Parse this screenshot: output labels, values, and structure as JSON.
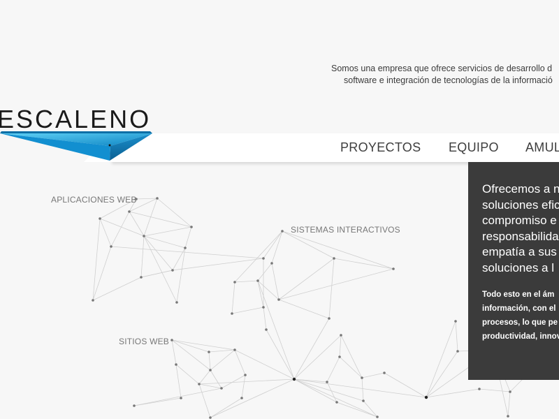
{
  "header": {
    "tagline_line1": "Somos una empresa que ofrece servicios de desarrollo d",
    "tagline_line2": "software e integración de tecnologías de la informació"
  },
  "logo": {
    "text": "ESCALENO"
  },
  "nav": {
    "items": [
      "PROYECTOS",
      "EQUIPO",
      "AMUL"
    ]
  },
  "graph": {
    "labels": {
      "apps": "APLICACIONES WEB",
      "interactive": "SISTEMAS INTERACTIVOS",
      "sites": "SITIOS WEB"
    }
  },
  "panel": {
    "lead_lines": [
      "Ofrecemos a n",
      "soluciones efic",
      "compromiso e",
      "responsabilida",
      "empatía a sus",
      "soluciones a l"
    ],
    "detail_lines": [
      "Todo esto en el ám",
      "información, con el",
      "procesos, lo que pe",
      "productividad, innov"
    ]
  },
  "colors": {
    "background": "#f7f7f7",
    "panel": "#3b3b3b",
    "logo_blue": "#1ba1dc",
    "node": "#777777",
    "edge": "#cfcfcf"
  }
}
